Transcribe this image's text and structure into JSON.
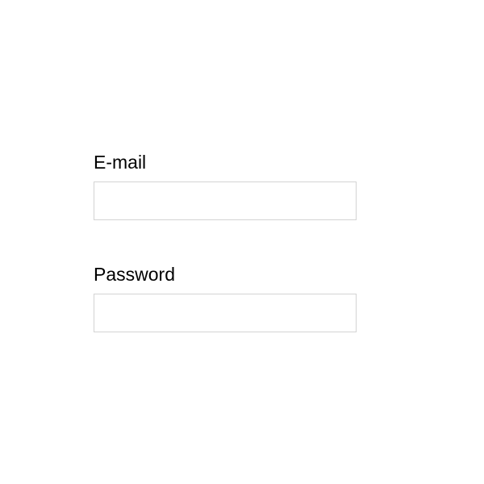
{
  "form": {
    "email": {
      "label": "E-mail",
      "value": ""
    },
    "password": {
      "label": "Password",
      "value": ""
    }
  }
}
